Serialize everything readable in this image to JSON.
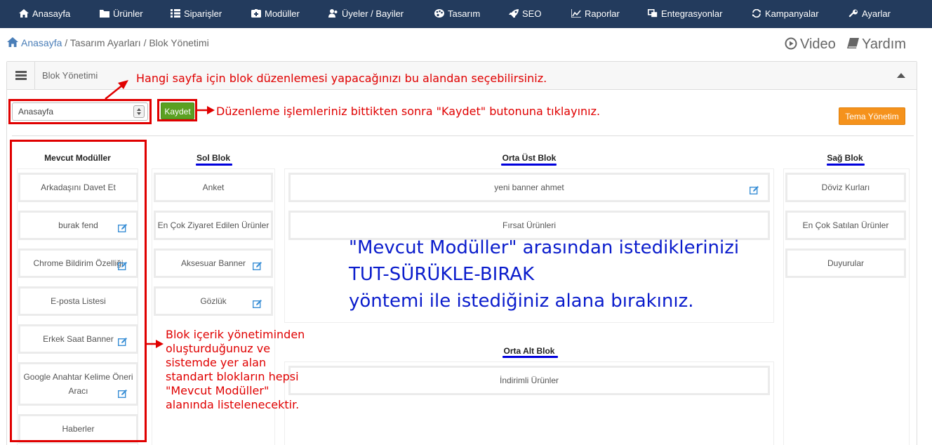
{
  "nav": {
    "items": [
      {
        "label": "Anasayfa",
        "icon": "home-icon"
      },
      {
        "label": "Ürünler",
        "icon": "folder-icon"
      },
      {
        "label": "Siparişler",
        "icon": "list-icon"
      },
      {
        "label": "Modüller",
        "icon": "module-icon"
      },
      {
        "label": "Üyeler / Bayiler",
        "icon": "users-icon"
      },
      {
        "label": "Tasarım",
        "icon": "palette-icon"
      },
      {
        "label": "SEO",
        "icon": "rocket-icon"
      },
      {
        "label": "Raporlar",
        "icon": "chart-icon"
      },
      {
        "label": "Entegrasyonlar",
        "icon": "integration-icon"
      },
      {
        "label": "Kampanyalar",
        "icon": "refresh-icon"
      },
      {
        "label": "Ayarlar",
        "icon": "wrench-icon"
      }
    ]
  },
  "breadcrumb": {
    "home": "Anasayfa",
    "rest": " / Tasarım Ayarları / Blok Yönetimi"
  },
  "help": {
    "video": "Video",
    "help": "Yardım"
  },
  "panel": {
    "title": "Blok Yönetimi",
    "select_value": "Anasayfa",
    "save_label": "Kaydet",
    "theme_label": "Tema Yönetim"
  },
  "columns": {
    "available": {
      "title": "Mevcut Modüller",
      "items": [
        {
          "label": "Arkadaşını Davet Et",
          "editable": false
        },
        {
          "label": "burak fend",
          "editable": true
        },
        {
          "label": "Chrome Bildirim Özelliği",
          "editable": true
        },
        {
          "label": "E-posta Listesi",
          "editable": false
        },
        {
          "label": "Erkek Saat Banner",
          "editable": true
        },
        {
          "label": "Google Anahtar Kelime Öneri Aracı",
          "editable": true
        },
        {
          "label": "Haberler",
          "editable": false
        }
      ]
    },
    "left": {
      "title": "Sol Blok",
      "items": [
        {
          "label": "Anket",
          "editable": false
        },
        {
          "label": "En Çok Ziyaret Edilen Ürünler",
          "editable": false
        },
        {
          "label": "Aksesuar Banner",
          "editable": true
        },
        {
          "label": "Gözlük",
          "editable": true
        }
      ]
    },
    "center_top": {
      "title": "Orta Üst Blok",
      "items": [
        {
          "label": "yeni banner ahmet",
          "editable": true
        },
        {
          "label": "Fırsat Ürünleri",
          "editable": false
        }
      ]
    },
    "center_bottom": {
      "title": "Orta Alt Blok",
      "items": [
        {
          "label": "İndirimli Ürünler",
          "editable": false
        }
      ]
    },
    "right": {
      "title": "Sağ Blok",
      "items": [
        {
          "label": "Döviz Kurları",
          "editable": false
        },
        {
          "label": "En Çok Satılan Ürünler",
          "editable": false
        },
        {
          "label": "Duyurular",
          "editable": false
        }
      ]
    }
  },
  "annotations": {
    "select_hint": "Hangi sayfa için blok düzenlemesi yapacağınızı bu alandan seçebilirsiniz.",
    "save_hint": "Düzenleme işlemleriniz bittikten sonra \"Kaydet\" butonuna tıklayınız.",
    "drag_hint": [
      "\"Mevcut Modüller\" arasından istediklerinizi",
      "TUT-SÜRÜKLE-BIRAK",
      "yöntemi ile istediğiniz alana bırakınız."
    ],
    "modules_hint": [
      "Blok içerik yönetiminden",
      "oluşturduğunuz ve",
      "sistemde yer alan",
      "standart blokların hepsi",
      "\"Mevcut Modüller\"",
      "alanında listelenecektir."
    ]
  },
  "colors": {
    "nav_bg": "#233b5d",
    "save_green": "#5aa022",
    "theme_orange": "#f5921c",
    "annotation_red": "#e00000",
    "annotation_blue": "#0a1ccc",
    "edit_icon_blue": "#3a8fd6"
  }
}
